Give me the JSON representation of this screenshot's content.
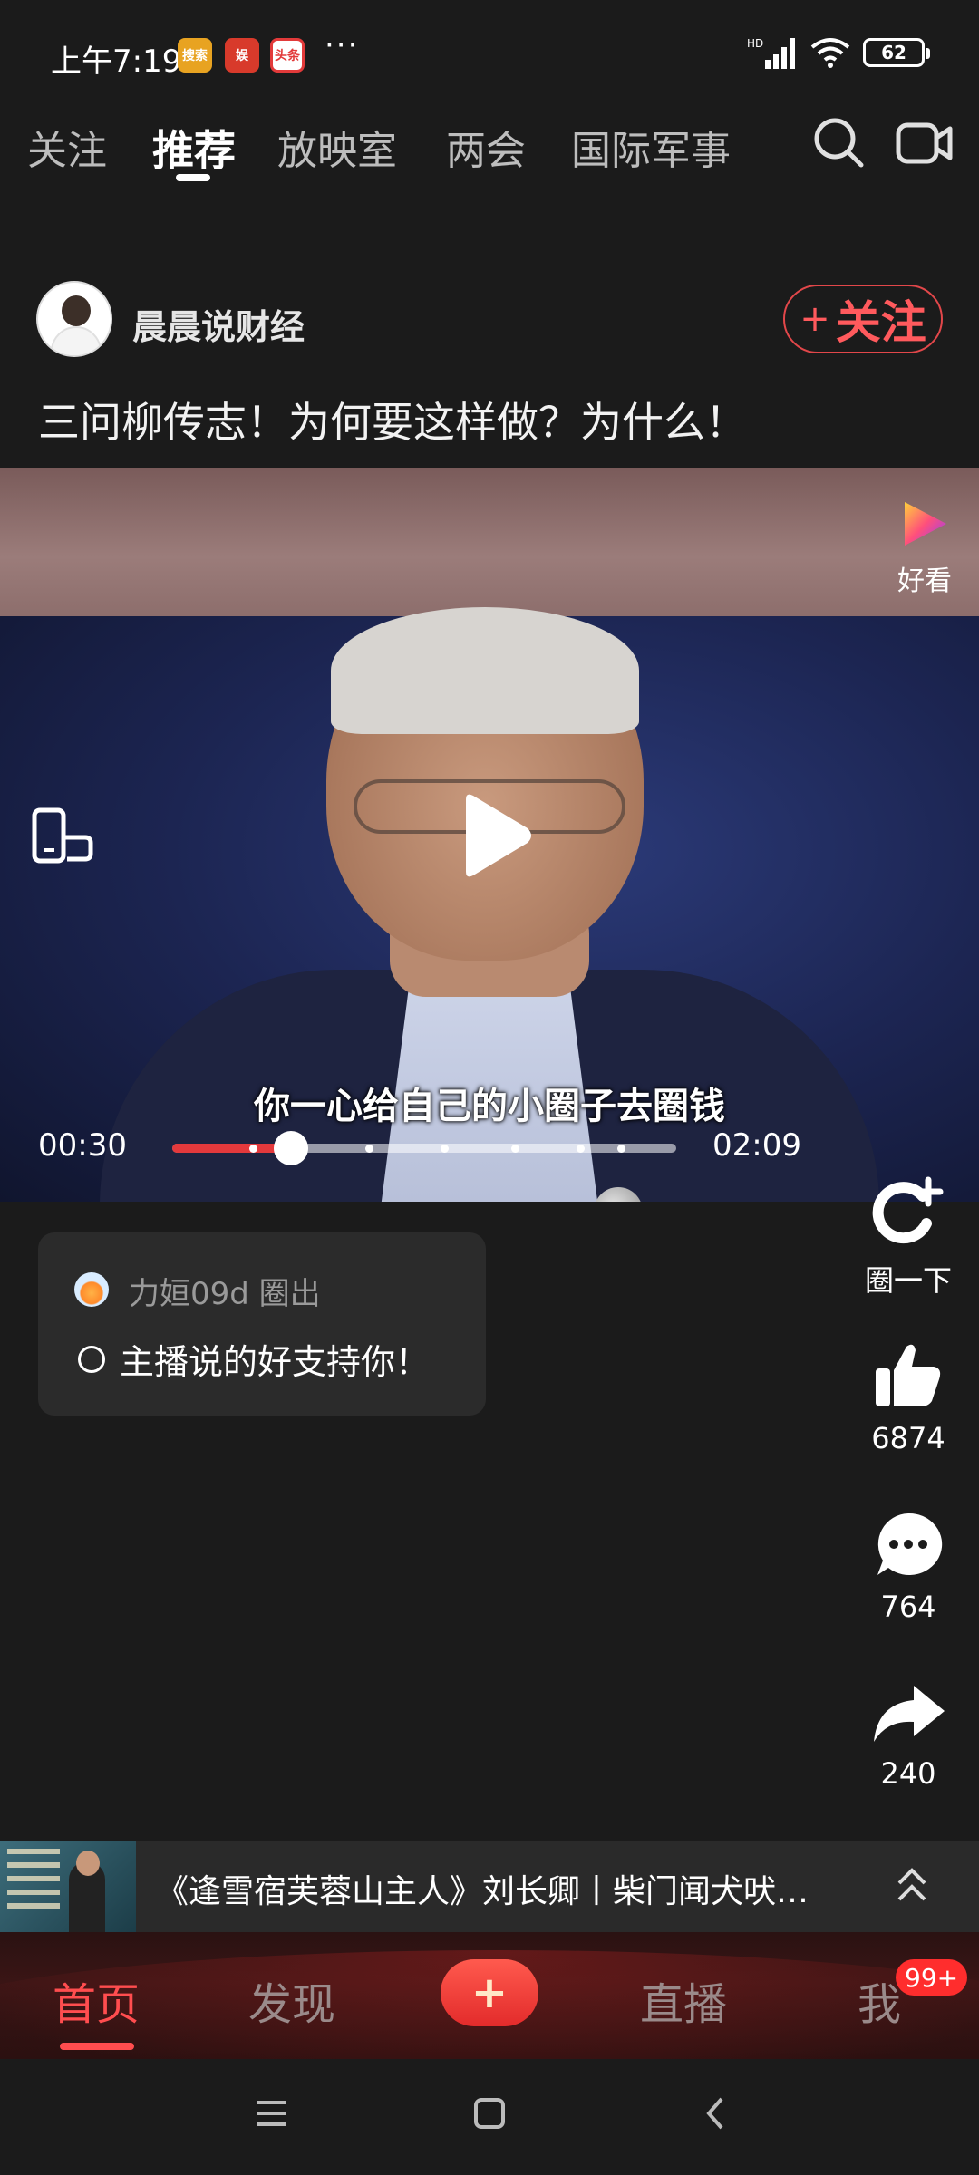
{
  "status_bar": {
    "time": "上午7:19",
    "app_icons": [
      {
        "label": "搜索",
        "color": "#e8a321"
      },
      {
        "label": "娱",
        "color": "#d83a2b"
      },
      {
        "label": "头条",
        "color": "#e23a3a"
      }
    ],
    "more": "···",
    "network": "HD",
    "battery": "62"
  },
  "top_tabs": {
    "items": [
      "关注",
      "推荐",
      "放映室",
      "两会",
      "国际军事"
    ],
    "active_index": 1
  },
  "post": {
    "author_name": "晨晨说财经",
    "follow_label": "关注",
    "title": "三问柳传志！为何要这样做？为什么！"
  },
  "video": {
    "brand_label": "好看",
    "subtitle": "你一心给自己的小圈子去圈钱",
    "current_time": "00:30",
    "total_time": "02:09",
    "progress_fraction": 0.235,
    "chapter_marks": [
      0.16,
      0.39,
      0.54,
      0.68,
      0.81,
      0.89
    ]
  },
  "comment": {
    "user_line": "力姮09d 圈出",
    "text": "主播说的好支持你！"
  },
  "actions": [
    {
      "name": "circle",
      "label": "圈一下"
    },
    {
      "name": "like",
      "label": "6874"
    },
    {
      "name": "comment",
      "label": "764"
    },
    {
      "name": "share",
      "label": "240"
    }
  ],
  "playlist": {
    "text": "《逢雪宿芙蓉山主人》刘长卿丨柴门闻犬吠，…"
  },
  "bottom_nav": {
    "items": [
      "首页",
      "发现",
      "直播",
      "我"
    ],
    "active_index": 0,
    "add_symbol": "+",
    "badge": "99+"
  },
  "colors": {
    "accent": "#ff4d4f",
    "background": "#1b1b1b",
    "progress": "#e4393c"
  }
}
